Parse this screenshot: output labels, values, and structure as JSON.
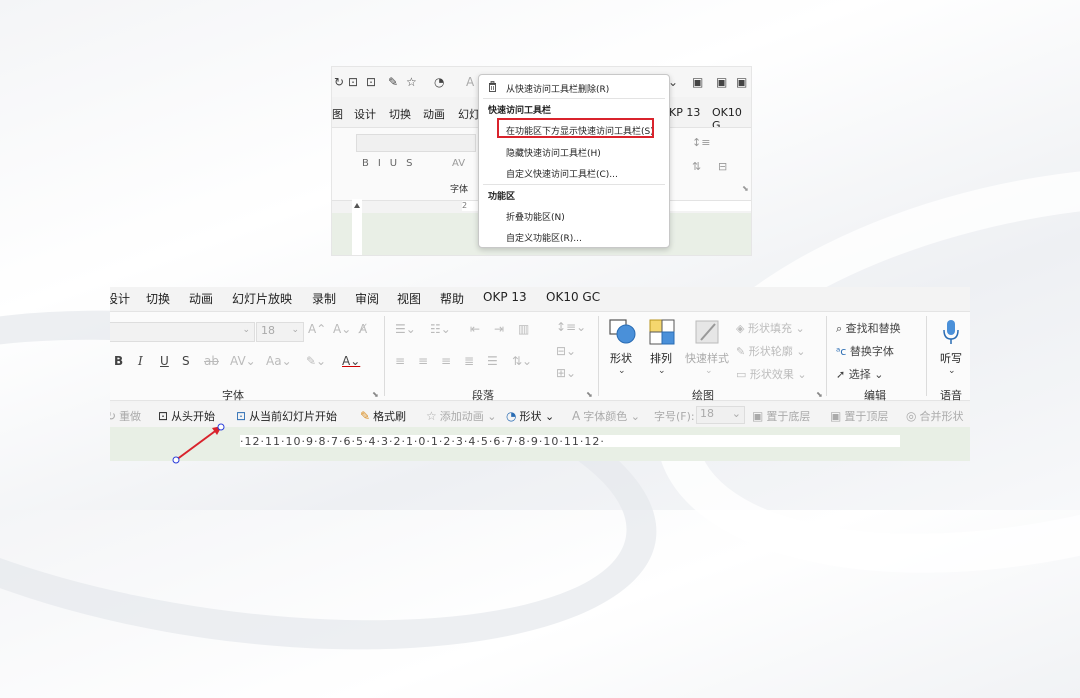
{
  "top_screenshot": {
    "tabs": [
      "图",
      "设计",
      "切换",
      "动画",
      "幻灯",
      "KP 13",
      "OK10 G"
    ],
    "font_group_label": "字体",
    "ruler_text": "2 · 1 · 0 · 1 · 2",
    "context_menu": {
      "items": [
        {
          "label": "从快速访问工具栏删除(R)",
          "type": "item"
        },
        {
          "label": "快速访问工具栏",
          "type": "header"
        },
        {
          "label": "在功能区下方显示快速访问工具栏(S)",
          "type": "item",
          "highlighted": true
        },
        {
          "label": "隐藏快速访问工具栏(H)",
          "type": "item"
        },
        {
          "label": "自定义快速访问工具栏(C)...",
          "type": "item"
        },
        {
          "label": "功能区",
          "type": "header"
        },
        {
          "label": "折叠功能区(N)",
          "type": "item"
        },
        {
          "label": "自定义功能区(R)...",
          "type": "item"
        }
      ]
    }
  },
  "bottom_screenshot": {
    "tabs": [
      "设计",
      "切换",
      "动画",
      "幻灯片放映",
      "录制",
      "审阅",
      "视图",
      "帮助",
      "OKP 13",
      "OK10 GC"
    ],
    "font_size_value": "18",
    "groups": {
      "font": "字体",
      "paragraph": "段落",
      "drawing": "绘图",
      "editing": "编辑",
      "voice": "语音"
    },
    "drawing": {
      "shapes": "形状",
      "arrange": "排列",
      "quick_styles": "快速样式",
      "shape_fill": "形状填充",
      "shape_outline": "形状轮廓",
      "shape_effects": "形状效果"
    },
    "editing": {
      "find_replace": "查找和替换",
      "replace_font": "替换字体",
      "select": "选择"
    },
    "voice": {
      "dictate": "听写"
    },
    "qat": [
      {
        "label": "重做",
        "enabled": false,
        "icon": "redo-icon"
      },
      {
        "label": "从头开始",
        "enabled": true,
        "icon": "slideshow-icon"
      },
      {
        "label": "从当前幻灯片开始",
        "enabled": true,
        "icon": "slideshow-current-icon"
      },
      {
        "label": "格式刷",
        "enabled": true,
        "icon": "format-painter-icon"
      },
      {
        "label": "添加动画",
        "enabled": false,
        "icon": "star-icon"
      },
      {
        "label": "形状",
        "enabled": true,
        "icon": "shapes-icon"
      },
      {
        "label": "字体颜色",
        "enabled": false,
        "icon": "font-color-icon"
      },
      {
        "label": "字号(F):",
        "enabled": false,
        "icon": ""
      },
      {
        "label": "18",
        "enabled": false,
        "icon": ""
      },
      {
        "label": "置于底层",
        "enabled": false,
        "icon": "send-back-icon"
      },
      {
        "label": "置于顶层",
        "enabled": false,
        "icon": "bring-front-icon"
      },
      {
        "label": "合并形状",
        "enabled": false,
        "icon": "merge-shapes-icon"
      }
    ],
    "ruler_text": "·12·11·10·9·8·7·6·5·4·3·2·1·0·1·2·3·4·5·6·7·8·9·10·11·12·"
  },
  "colors": {
    "highlight_box": "#d9232c",
    "arrow": "#d9232c",
    "slide_bg": "#e8efe5"
  }
}
